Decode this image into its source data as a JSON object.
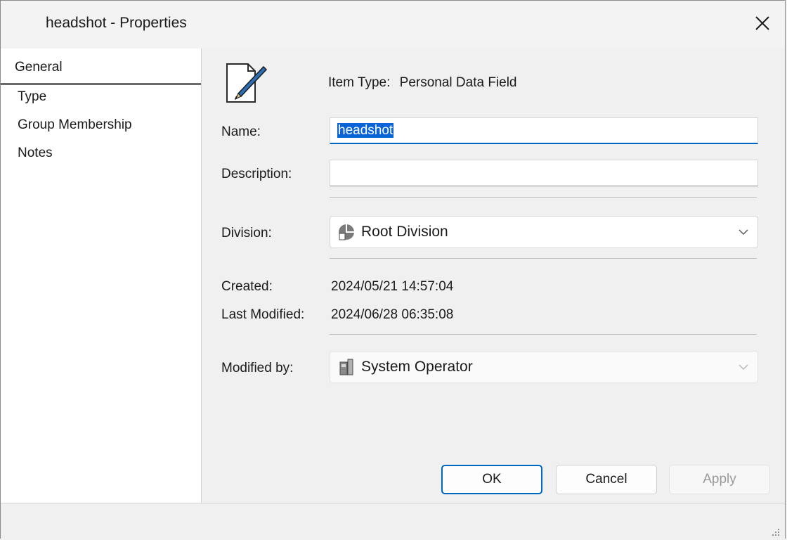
{
  "window": {
    "title": "headshot - Properties",
    "close_icon": "close-icon"
  },
  "sidebar": {
    "items": [
      {
        "label": "General",
        "selected": true
      },
      {
        "label": "Type",
        "selected": false
      },
      {
        "label": "Group Membership",
        "selected": false
      },
      {
        "label": "Notes",
        "selected": false
      }
    ]
  },
  "general": {
    "item_icon": "edit-document-icon",
    "item_type_label": "Item Type:",
    "item_type_value": "Personal Data Field",
    "name_label": "Name:",
    "name_value": "headshot",
    "description_label": "Description:",
    "description_value": "",
    "division_label": "Division:",
    "division_value": "Root Division",
    "division_icon": "division-icon",
    "created_label": "Created:",
    "created_value": "2024/05/21 14:57:04",
    "last_modified_label": "Last Modified:",
    "last_modified_value": "2024/06/28 06:35:08",
    "modified_by_label": "Modified by:",
    "modified_by_value": "System Operator",
    "modified_by_icon": "operator-icon"
  },
  "buttons": {
    "ok": "OK",
    "cancel": "Cancel",
    "apply": "Apply"
  },
  "colors": {
    "accent": "#0067c0",
    "selection": "#0a64d8"
  }
}
